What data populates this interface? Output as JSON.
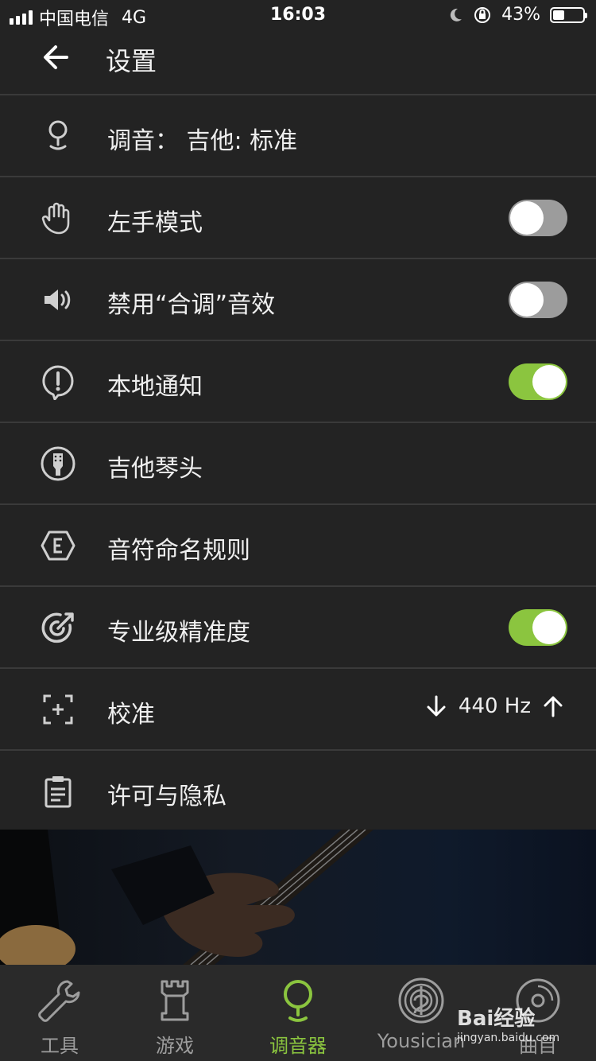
{
  "status": {
    "carrier": "中国电信",
    "network": "4G",
    "time": "16:03",
    "battery": "43%"
  },
  "header": {
    "title": "设置"
  },
  "rows": [
    {
      "label": "调音： 吉他: 标准",
      "icon": "tuning-pin-icon"
    },
    {
      "label": "左手模式",
      "icon": "hand-icon",
      "toggle": false
    },
    {
      "label": "禁用“合调”音效",
      "icon": "speaker-icon",
      "toggle": false
    },
    {
      "label": "本地通知",
      "icon": "notification-icon",
      "toggle": true
    },
    {
      "label": "吉他琴头",
      "icon": "guitar-headstock-icon"
    },
    {
      "label": "音符命名规则",
      "icon": "note-naming-icon"
    },
    {
      "label": "专业级精准度",
      "icon": "target-icon",
      "toggle": true
    },
    {
      "label": "校准",
      "icon": "calibration-icon",
      "value": "440 Hz"
    },
    {
      "label": "许可与隐私",
      "icon": "clipboard-icon"
    }
  ],
  "tabs": [
    {
      "label": "工具",
      "icon": "wrench-icon",
      "active": false
    },
    {
      "label": "游戏",
      "icon": "castle-icon",
      "active": false
    },
    {
      "label": "调音器",
      "icon": "tuner-icon",
      "active": true
    },
    {
      "label": "Yousician",
      "icon": "yousician-logo-icon",
      "active": false
    },
    {
      "label": "曲目",
      "icon": "disc-icon",
      "active": false
    }
  ],
  "watermark": {
    "brand": "Bai经验",
    "url": "jingyan.baidu.com"
  },
  "colors": {
    "accent": "#8bc53f",
    "background": "#232323",
    "divider": "#3a3a3a"
  }
}
